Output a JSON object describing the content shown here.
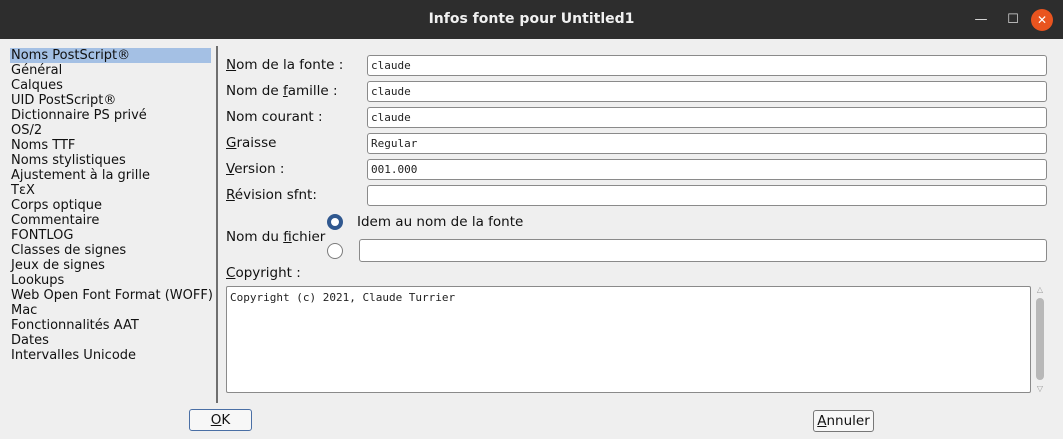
{
  "window": {
    "title": "Infos fonte pour Untitled1",
    "minimize_glyph": "—",
    "maximize_glyph": "☐",
    "close_glyph": "✕"
  },
  "sidebar": {
    "items": [
      "Noms PostScript®",
      "Général",
      "Calques",
      "UID PostScript®",
      "Dictionnaire PS privé",
      "OS/2",
      "Noms TTF",
      "Noms stylistiques",
      "Ajustement à la grille",
      "TεX",
      "Corps optique",
      "Commentaire",
      "FONTLOG",
      "Classes de signes",
      "Jeux de signes",
      "Lookups",
      "Web Open Font Format (WOFF)",
      "Mac",
      "Fonctionnalités AAT",
      "Dates",
      "Intervalles Unicode"
    ],
    "selected_index": 0
  },
  "form": {
    "fontname": {
      "mnemonic": "N",
      "label": "om de la fonte :",
      "value": "claude"
    },
    "family": {
      "label_pre": "Nom de ",
      "mnemonic": "f",
      "label_post": "amille :",
      "value": "claude"
    },
    "fullname": {
      "label": "Nom courant :",
      "value": "claude"
    },
    "weight": {
      "mnemonic": "G",
      "label": "raisse",
      "value": "Regular"
    },
    "version": {
      "mnemonic": "V",
      "label": "ersion :",
      "value": "001.000"
    },
    "sfnt_revision": {
      "mnemonic": "R",
      "label": "évision sfnt:",
      "value": ""
    },
    "filename": {
      "label_pre": "Nom du ",
      "mnemonic": "f",
      "label_post": "ichier",
      "radio_same_label": "Idem au nom de la fonte",
      "radio_same_selected": true,
      "custom_value": ""
    },
    "copyright": {
      "mnemonic": "C",
      "label": "opyright :",
      "value": "Copyright (c) 2021, Claude Turrier"
    }
  },
  "buttons": {
    "ok": {
      "mnemonic": "O",
      "label": "K"
    },
    "cancel": {
      "mnemonic": "A",
      "label": "nnuler"
    }
  },
  "scroll": {
    "up_glyph": "△",
    "down_glyph": "▽"
  },
  "colors": {
    "titlebar": "#2d2d2d",
    "close_button": "#e9541f",
    "selection": "#a4c0e4",
    "radio_accent": "#30588f"
  }
}
